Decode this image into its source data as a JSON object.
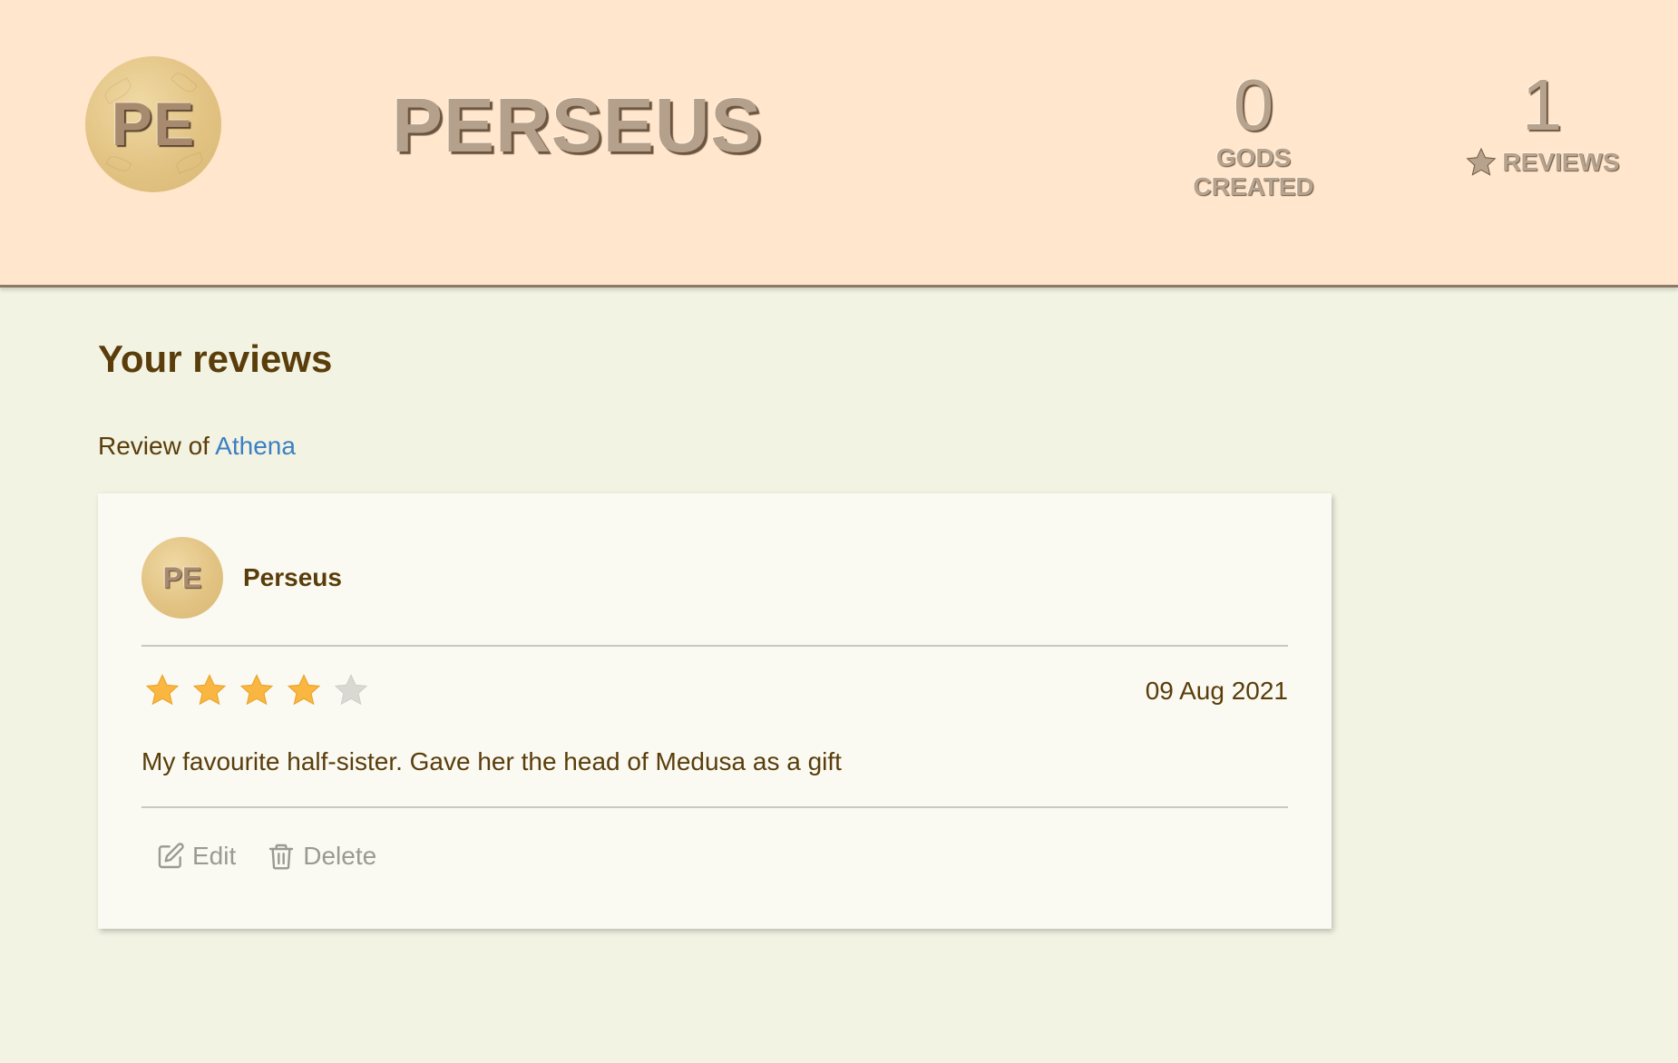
{
  "profile": {
    "avatar_initials": "PE",
    "username": "PERSEUS",
    "stats": {
      "gods_created": {
        "value": "0",
        "label": "GODS CREATED"
      },
      "reviews": {
        "value": "1",
        "label": "REVIEWS",
        "icon": "star-icon"
      }
    }
  },
  "reviews_section": {
    "title": "Your reviews",
    "items": [
      {
        "review_of_prefix": "Review of",
        "subject": "Athena",
        "reviewer_initials": "PE",
        "reviewer_name": "Perseus",
        "rating": 4,
        "max_rating": 5,
        "date": "09 Aug 2021",
        "text": "My favourite half-sister. Gave her the head of Medusa as a gift",
        "actions": {
          "edit_label": "Edit",
          "delete_label": "Delete"
        }
      }
    ]
  },
  "colors": {
    "header_bg": "#ffe6cc",
    "page_bg": "#f2f3e2",
    "text_brown": "#5a3d0b",
    "link_blue": "#3c7fc2",
    "star_filled": "#f9b640",
    "star_empty": "#d9d9d4"
  }
}
